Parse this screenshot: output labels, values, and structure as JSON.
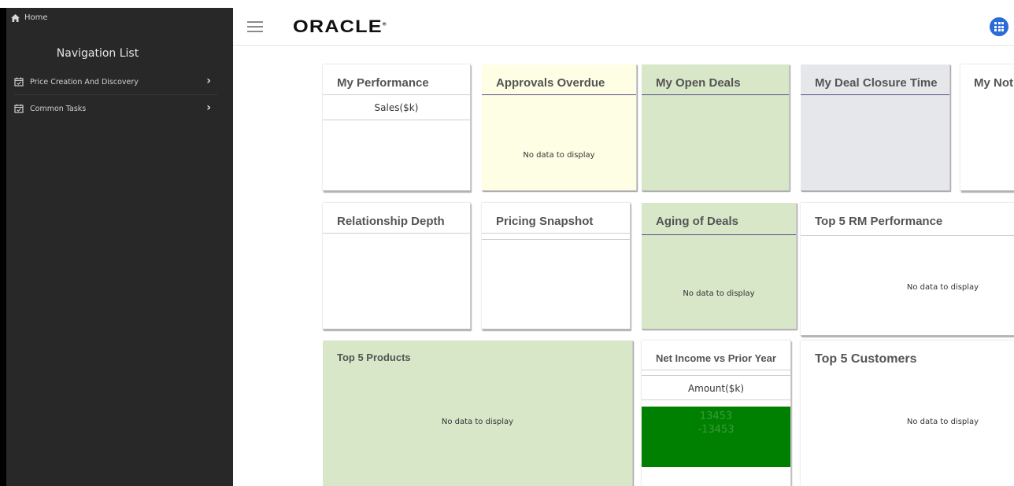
{
  "sidebar": {
    "home_label": "Home",
    "title": "Navigation List",
    "items": [
      {
        "label": "Price Creation And Discovery"
      },
      {
        "label": "Common Tasks"
      }
    ]
  },
  "header": {
    "brand": "ORACLE",
    "brand_mark": "®",
    "apps_button_color": "#2a6bd8"
  },
  "tiles": {
    "my_performance": {
      "title": "My Performance",
      "subhead": "Sales($k)"
    },
    "approvals_overdue": {
      "title": "Approvals Overdue",
      "empty": "No data to display"
    },
    "my_open_deals": {
      "title": "My Open Deals"
    },
    "my_deal_closure_time": {
      "title": "My Deal Closure Time"
    },
    "my_notes": {
      "title": "My Not"
    },
    "relationship_depth": {
      "title": "Relationship Depth"
    },
    "pricing_snapshot": {
      "title": "Pricing Snapshot"
    },
    "aging_of_deals": {
      "title": "Aging of Deals",
      "empty": "No data to display"
    },
    "top5_rm": {
      "title": "Top 5 RM Performance",
      "empty": "No data to display"
    },
    "top5_products": {
      "title": "Top 5 Products",
      "empty": "No data to display"
    },
    "net_income": {
      "title": "Net Income vs Prior Year",
      "subhead": "Amount($k)",
      "value": "13453",
      "delta": "-13453"
    },
    "top5_customers": {
      "title": "Top 5 Customers",
      "empty": "No data to display"
    }
  },
  "colors": {
    "sidebar_bg": "#282828",
    "tile_yellow": "#fefee5",
    "tile_green": "#d7e7c8",
    "tile_gray": "#e6e7ea",
    "accent_purple": "#5b4a89",
    "net_income_fill": "#008000"
  }
}
